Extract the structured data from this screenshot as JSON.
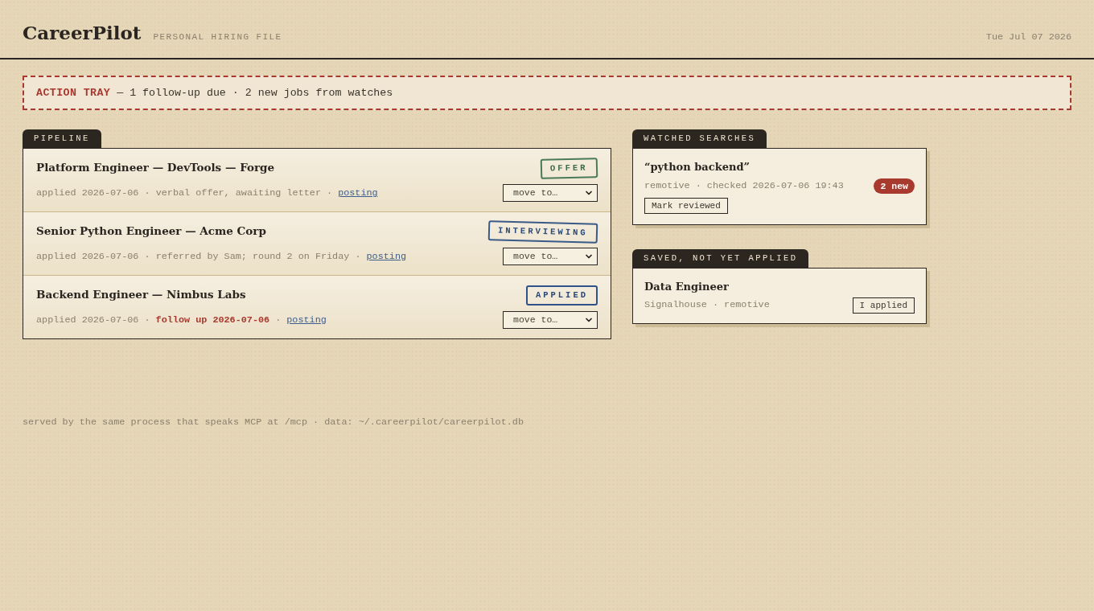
{
  "header": {
    "title": "CareerPilot",
    "subtitle": "PERSONAL HIRING FILE",
    "date": "Tue Jul 07 2026"
  },
  "action_tray": {
    "label": "ACTION TRAY",
    "summary": "— 1 follow-up due · 2 new jobs from watches"
  },
  "pipeline": {
    "title": "PIPELINE",
    "jobs": [
      {
        "title": "Platform Engineer — DevTools — Forge",
        "meta": [
          {
            "kind": "text",
            "text": "applied 2026-07-06 · verbal offer, awaiting letter ·"
          },
          {
            "kind": "link",
            "text": "posting"
          }
        ],
        "stage": {
          "kind": "offer",
          "label": "OFFER"
        },
        "move_select": "move to…"
      },
      {
        "title": "Senior Python Engineer — Acme Corp",
        "meta": [
          {
            "kind": "text",
            "text": "applied 2026-07-06 · referred by Sam; round 2 on Friday ·"
          },
          {
            "kind": "link",
            "text": "posting"
          }
        ],
        "stage": {
          "kind": "interviewing",
          "label": "INTERVIEWING"
        },
        "move_select": "move to…"
      },
      {
        "title": "Backend Engineer — Nimbus Labs",
        "meta": [
          {
            "kind": "text",
            "text": "applied 2026-07-06 ·"
          },
          {
            "kind": "alert",
            "text": "follow up 2026-07-06"
          },
          {
            "kind": "text",
            "text": "·"
          },
          {
            "kind": "link",
            "text": "posting"
          }
        ],
        "stage": {
          "kind": "applied",
          "label": "APPLIED"
        },
        "move_select": "move to…"
      }
    ]
  },
  "watched_searches": {
    "title": "WATCHED SEARCHES",
    "items": [
      {
        "query": "“python backend”",
        "meta": "remotive · checked 2026-07-06 19:43",
        "badge": "2 new",
        "button": "Mark reviewed"
      }
    ]
  },
  "saved": {
    "title": "SAVED, NOT YET APPLIED",
    "items": [
      {
        "title": "Data Engineer",
        "meta": "Signalhouse · remotive",
        "button": "I applied"
      }
    ]
  },
  "footer": "served by the same process that speaks MCP at /mcp · data: ~/.careerpilot/careerpilot.db"
}
